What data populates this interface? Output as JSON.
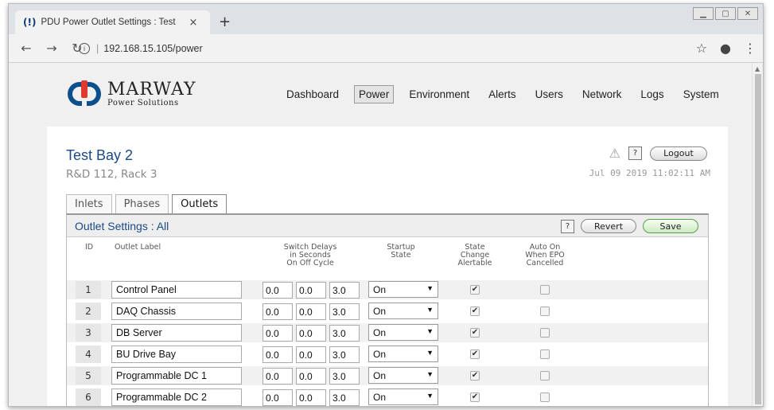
{
  "browser": {
    "tab_title": "PDU Power Outlet Settings : Test",
    "tab_close": "×",
    "new_tab": "+",
    "url": "192.168.15.105/power"
  },
  "header": {
    "brand": "MARWAY",
    "brand_sub": "Power Solutions",
    "nav": [
      "Dashboard",
      "Power",
      "Environment",
      "Alerts",
      "Users",
      "Network",
      "Logs",
      "System"
    ],
    "active_nav": "Power"
  },
  "site": {
    "name": "Test Bay 2",
    "location": "R&D 112, Rack 3",
    "timestamp": "Jul 09 2019 11:02:11 AM",
    "help": "?",
    "logout": "Logout"
  },
  "tabs": [
    "Inlets",
    "Phases",
    "Outlets"
  ],
  "active_tab": "Outlets",
  "settings": {
    "title": "Outlet Settings : All",
    "help": "?",
    "revert": "Revert",
    "save": "Save",
    "columns": {
      "id": "ID",
      "label": "Outlet Label",
      "delays_1": "Switch Delays",
      "delays_2": "in Seconds",
      "delay_on": "On",
      "delay_off": "Off",
      "delay_cycle": "Cycle",
      "startup_1": "Startup",
      "startup_2": "State",
      "alert_1": "State",
      "alert_2": "Change",
      "alert_3": "Alertable",
      "auto_1": "Auto On",
      "auto_2": "When EPO",
      "auto_3": "Cancelled"
    },
    "rows": [
      {
        "id": "1",
        "label": "Control Panel",
        "on": "0.0",
        "off": "0.0",
        "cycle": "3.0",
        "startup": "On",
        "alertable": true,
        "auto_on": false
      },
      {
        "id": "2",
        "label": "DAQ Chassis",
        "on": "0.0",
        "off": "0.0",
        "cycle": "3.0",
        "startup": "On",
        "alertable": true,
        "auto_on": false
      },
      {
        "id": "3",
        "label": "DB Server",
        "on": "0.0",
        "off": "0.0",
        "cycle": "3.0",
        "startup": "On",
        "alertable": true,
        "auto_on": false
      },
      {
        "id": "4",
        "label": "BU Drive Bay",
        "on": "0.0",
        "off": "0.0",
        "cycle": "3.0",
        "startup": "On",
        "alertable": true,
        "auto_on": false
      },
      {
        "id": "5",
        "label": "Programmable DC 1",
        "on": "0.0",
        "off": "0.0",
        "cycle": "3.0",
        "startup": "On",
        "alertable": true,
        "auto_on": false
      },
      {
        "id": "6",
        "label": "Programmable DC 2",
        "on": "0.0",
        "off": "0.0",
        "cycle": "3.0",
        "startup": "On",
        "alertable": true,
        "auto_on": false
      }
    ]
  },
  "colors": {
    "accent": "#1b4a85",
    "brand_blue": "#0b4f8c",
    "brand_red": "#e03a2e",
    "save_green": "#5a9f4a"
  }
}
